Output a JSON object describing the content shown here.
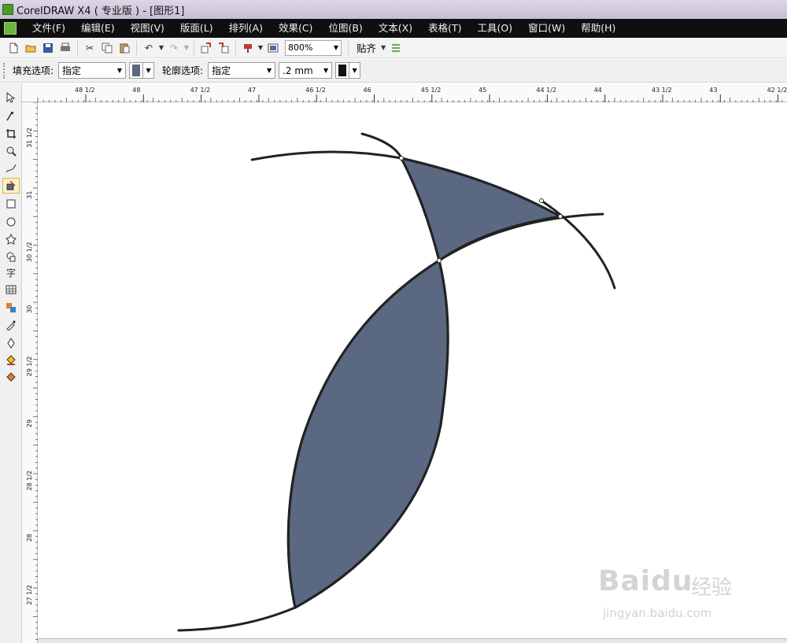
{
  "window": {
    "title": "CorelDRAW X4 ( 专业版 ) - [图形1]"
  },
  "menu": [
    "文件(F)",
    "编辑(E)",
    "视图(V)",
    "版面(L)",
    "排列(A)",
    "效果(C)",
    "位图(B)",
    "文本(X)",
    "表格(T)",
    "工具(O)",
    "窗口(W)",
    "帮助(H)"
  ],
  "toolbar": {
    "zoom": "800%",
    "snap": "贴齐"
  },
  "propbar": {
    "fill_label": "填充选项:",
    "fill_value": "指定",
    "outline_label": "轮廓选项:",
    "outline_value": "指定",
    "outline_width": ".2 mm",
    "fill_color": "#5a6882",
    "outline_color": "#111111"
  },
  "ruler": {
    "unit_corner": "in",
    "h_labels": [
      "48 1/2",
      "48",
      "47 1/2",
      "47",
      "46 1/2",
      "46",
      "45 1/2",
      "45",
      "44 1/2",
      "44",
      "43 1/2",
      "43",
      "42 1/2"
    ],
    "v_labels": [
      "31 1/2",
      "31",
      "30 1/2",
      "30",
      "29 1/2",
      "29",
      "28 1/2",
      "28",
      "27 1/2"
    ]
  },
  "colors": {
    "shape_fill": "#5a6882",
    "stroke": "#222222"
  },
  "watermark": {
    "brand": "Baidu",
    "brand_cn": "经验",
    "url": "jingyan.baidu.com"
  }
}
